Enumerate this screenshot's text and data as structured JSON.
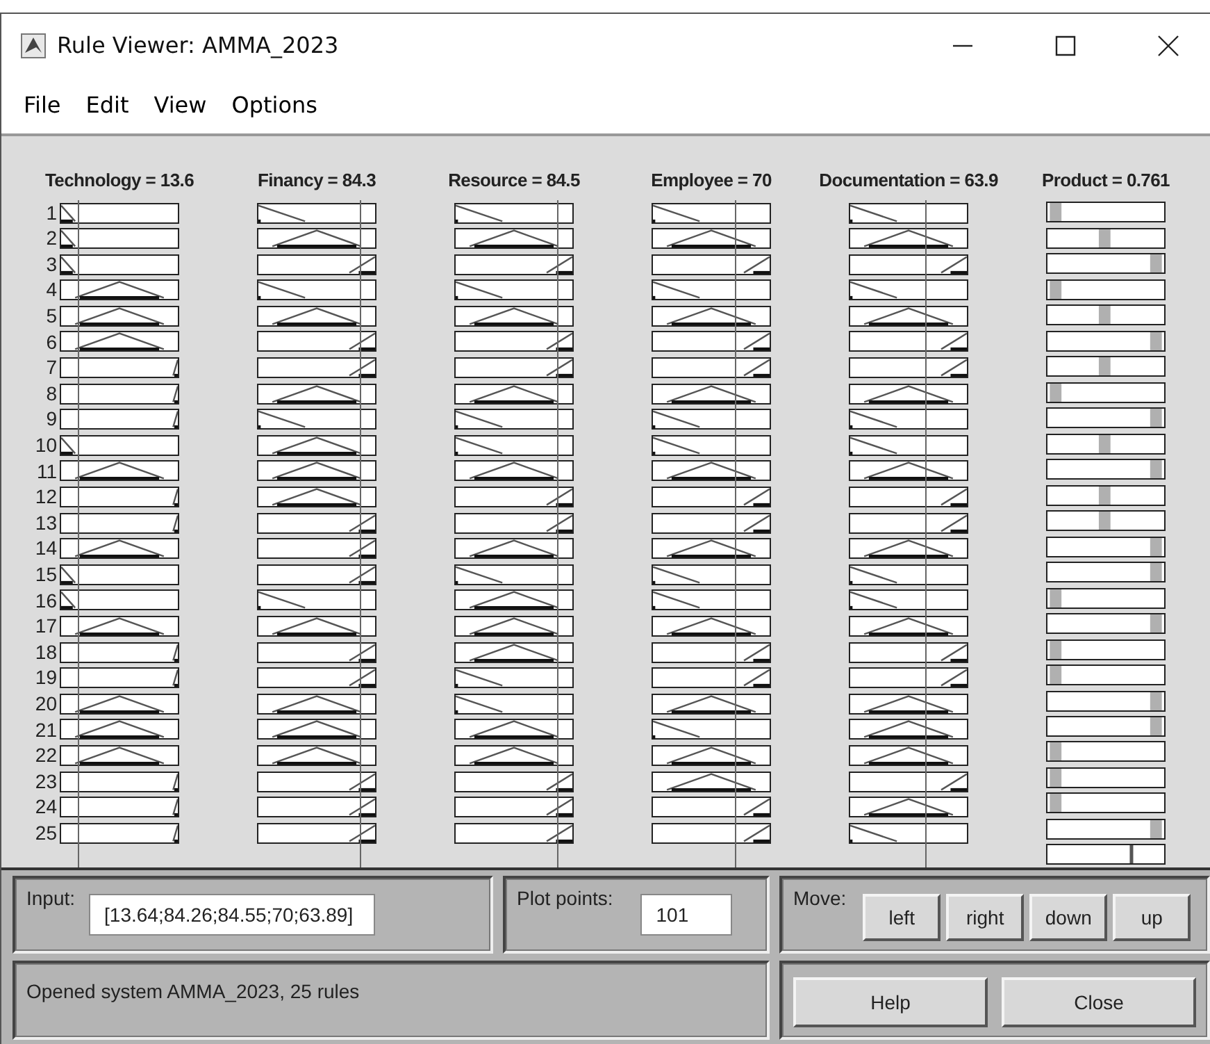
{
  "window": {
    "title": "Rule Viewer: AMMA_2023"
  },
  "menu": [
    "File",
    "Edit",
    "View",
    "Options"
  ],
  "inputs": [
    {
      "label": "Technology = 13.6",
      "level": 0.15
    },
    {
      "label": "Financy = 84.3",
      "level": 0.86
    },
    {
      "label": "Resource = 84.5",
      "level": 0.86
    },
    {
      "label": "Employee = 70",
      "level": 0.7
    },
    {
      "label": "Documentation = 63.9",
      "level": 0.64
    }
  ],
  "output": {
    "label": "Product = 0.761",
    "level": 0.72
  },
  "rules": [
    {
      "number": "1",
      "antecedents": [
        {
          "kind": "low"
        },
        {
          "kind": "low"
        },
        {
          "kind": "low"
        },
        {
          "kind": "low"
        },
        {
          "kind": "low"
        }
      ],
      "consequent": {
        "kind": "low"
      }
    },
    {
      "number": "2",
      "antecedents": [
        {
          "kind": "low"
        },
        {
          "kind": "mid"
        },
        {
          "kind": "mid"
        },
        {
          "kind": "mid"
        },
        {
          "kind": "mid"
        }
      ],
      "consequent": {
        "kind": "mid"
      }
    },
    {
      "number": "3",
      "antecedents": [
        {
          "kind": "low"
        },
        {
          "kind": "high"
        },
        {
          "kind": "high"
        },
        {
          "kind": "high"
        },
        {
          "kind": "high"
        }
      ],
      "consequent": {
        "kind": "high"
      }
    },
    {
      "number": "4",
      "antecedents": [
        {
          "kind": "mid"
        },
        {
          "kind": "low"
        },
        {
          "kind": "low"
        },
        {
          "kind": "low"
        },
        {
          "kind": "low"
        }
      ],
      "consequent": {
        "kind": "low"
      }
    },
    {
      "number": "5",
      "antecedents": [
        {
          "kind": "mid"
        },
        {
          "kind": "mid"
        },
        {
          "kind": "mid"
        },
        {
          "kind": "mid"
        },
        {
          "kind": "mid"
        }
      ],
      "consequent": {
        "kind": "mid"
      }
    },
    {
      "number": "6",
      "antecedents": [
        {
          "kind": "mid"
        },
        {
          "kind": "high"
        },
        {
          "kind": "high"
        },
        {
          "kind": "high"
        },
        {
          "kind": "high"
        }
      ],
      "consequent": {
        "kind": "high"
      }
    },
    {
      "number": "7",
      "antecedents": [
        {
          "kind": "high"
        },
        {
          "kind": "high"
        },
        {
          "kind": "high"
        },
        {
          "kind": "high"
        },
        {
          "kind": "high"
        }
      ],
      "consequent": {
        "kind": "mid"
      }
    },
    {
      "number": "8",
      "antecedents": [
        {
          "kind": "high"
        },
        {
          "kind": "mid"
        },
        {
          "kind": "mid"
        },
        {
          "kind": "mid"
        },
        {
          "kind": "mid"
        }
      ],
      "consequent": {
        "kind": "low"
      }
    },
    {
      "number": "9",
      "antecedents": [
        {
          "kind": "high"
        },
        {
          "kind": "low"
        },
        {
          "kind": "low"
        },
        {
          "kind": "low"
        },
        {
          "kind": "low"
        }
      ],
      "consequent": {
        "kind": "high"
      }
    },
    {
      "number": "10",
      "antecedents": [
        {
          "kind": "low"
        },
        {
          "kind": "mid"
        },
        {
          "kind": "low"
        },
        {
          "kind": "low"
        },
        {
          "kind": "low"
        }
      ],
      "consequent": {
        "kind": "mid"
      }
    },
    {
      "number": "11",
      "antecedents": [
        {
          "kind": "mid"
        },
        {
          "kind": "mid"
        },
        {
          "kind": "mid"
        },
        {
          "kind": "mid"
        },
        {
          "kind": "mid"
        }
      ],
      "consequent": {
        "kind": "high"
      }
    },
    {
      "number": "12",
      "antecedents": [
        {
          "kind": "high"
        },
        {
          "kind": "mid"
        },
        {
          "kind": "high"
        },
        {
          "kind": "high"
        },
        {
          "kind": "high"
        }
      ],
      "consequent": {
        "kind": "mid"
      }
    },
    {
      "number": "13",
      "antecedents": [
        {
          "kind": "high"
        },
        {
          "kind": "high"
        },
        {
          "kind": "high"
        },
        {
          "kind": "high"
        },
        {
          "kind": "high"
        }
      ],
      "consequent": {
        "kind": "mid"
      }
    },
    {
      "number": "14",
      "antecedents": [
        {
          "kind": "mid"
        },
        {
          "kind": "high"
        },
        {
          "kind": "mid"
        },
        {
          "kind": "mid"
        },
        {
          "kind": "mid"
        }
      ],
      "consequent": {
        "kind": "high"
      }
    },
    {
      "number": "15",
      "antecedents": [
        {
          "kind": "low"
        },
        {
          "kind": "high"
        },
        {
          "kind": "low"
        },
        {
          "kind": "low"
        },
        {
          "kind": "low"
        }
      ],
      "consequent": {
        "kind": "high"
      }
    },
    {
      "number": "16",
      "antecedents": [
        {
          "kind": "low"
        },
        {
          "kind": "low"
        },
        {
          "kind": "mid"
        },
        {
          "kind": "low"
        },
        {
          "kind": "low"
        }
      ],
      "consequent": {
        "kind": "low"
      }
    },
    {
      "number": "17",
      "antecedents": [
        {
          "kind": "mid"
        },
        {
          "kind": "mid"
        },
        {
          "kind": "mid"
        },
        {
          "kind": "mid"
        },
        {
          "kind": "mid"
        }
      ],
      "consequent": {
        "kind": "high"
      }
    },
    {
      "number": "18",
      "antecedents": [
        {
          "kind": "high"
        },
        {
          "kind": "high"
        },
        {
          "kind": "mid"
        },
        {
          "kind": "high"
        },
        {
          "kind": "high"
        }
      ],
      "consequent": {
        "kind": "low"
      }
    },
    {
      "number": "19",
      "antecedents": [
        {
          "kind": "high"
        },
        {
          "kind": "high"
        },
        {
          "kind": "low"
        },
        {
          "kind": "high"
        },
        {
          "kind": "high"
        }
      ],
      "consequent": {
        "kind": "low"
      }
    },
    {
      "number": "20",
      "antecedents": [
        {
          "kind": "mid"
        },
        {
          "kind": "mid"
        },
        {
          "kind": "low"
        },
        {
          "kind": "mid"
        },
        {
          "kind": "mid"
        }
      ],
      "consequent": {
        "kind": "high"
      }
    },
    {
      "number": "21",
      "antecedents": [
        {
          "kind": "mid"
        },
        {
          "kind": "mid"
        },
        {
          "kind": "mid"
        },
        {
          "kind": "low"
        },
        {
          "kind": "mid"
        }
      ],
      "consequent": {
        "kind": "high"
      }
    },
    {
      "number": "22",
      "antecedents": [
        {
          "kind": "mid"
        },
        {
          "kind": "mid"
        },
        {
          "kind": "mid"
        },
        {
          "kind": "mid"
        },
        {
          "kind": "mid"
        }
      ],
      "consequent": {
        "kind": "low"
      }
    },
    {
      "number": "23",
      "antecedents": [
        {
          "kind": "high"
        },
        {
          "kind": "high"
        },
        {
          "kind": "high"
        },
        {
          "kind": "mid"
        },
        {
          "kind": "high"
        }
      ],
      "consequent": {
        "kind": "low"
      }
    },
    {
      "number": "24",
      "antecedents": [
        {
          "kind": "high"
        },
        {
          "kind": "high"
        },
        {
          "kind": "high"
        },
        {
          "kind": "high"
        },
        {
          "kind": "mid"
        }
      ],
      "consequent": {
        "kind": "low"
      }
    },
    {
      "number": "25",
      "antecedents": [
        {
          "kind": "high"
        },
        {
          "kind": "high"
        },
        {
          "kind": "high"
        },
        {
          "kind": "high"
        },
        {
          "kind": "low"
        }
      ],
      "consequent": {
        "kind": "high"
      }
    }
  ],
  "input_field": {
    "label": "Input:",
    "value": "[13.64;84.26;84.55;70;63.89]"
  },
  "plot_points": {
    "label": "Plot points:",
    "value": "101"
  },
  "move": {
    "label": "Move:",
    "buttons": [
      "left",
      "right",
      "down",
      "up"
    ]
  },
  "status": "Opened system AMMA_2023, 25 rules",
  "buttons": [
    "Help",
    "Close"
  ]
}
